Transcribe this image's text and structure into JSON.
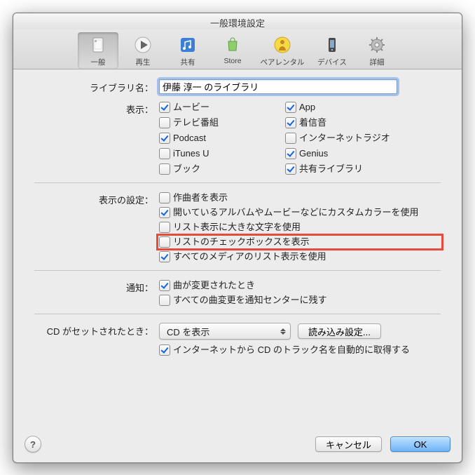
{
  "window": {
    "title": "一般環境設定"
  },
  "toolbar": {
    "items": [
      {
        "id": "general",
        "label": "一般",
        "selected": true
      },
      {
        "id": "playback",
        "label": "再生",
        "selected": false
      },
      {
        "id": "sharing",
        "label": "共有",
        "selected": false
      },
      {
        "id": "store",
        "label": "Store",
        "selected": false
      },
      {
        "id": "parental",
        "label": "ペアレンタル",
        "selected": false
      },
      {
        "id": "devices",
        "label": "デバイス",
        "selected": false
      },
      {
        "id": "advanced",
        "label": "詳細",
        "selected": false
      }
    ]
  },
  "form": {
    "library_name": {
      "label": "ライブラリ名：",
      "value": "伊藤 淳一 のライブラリ"
    },
    "show": {
      "label": "表示：",
      "items": [
        {
          "label": "ムービー",
          "checked": true
        },
        {
          "label": "App",
          "checked": true
        },
        {
          "label": "テレビ番組",
          "checked": false
        },
        {
          "label": "着信音",
          "checked": true
        },
        {
          "label": "Podcast",
          "checked": true
        },
        {
          "label": "インターネットラジオ",
          "checked": false
        },
        {
          "label": "iTunes U",
          "checked": false
        },
        {
          "label": "Genius",
          "checked": true
        },
        {
          "label": "ブック",
          "checked": false
        },
        {
          "label": "共有ライブラリ",
          "checked": true
        }
      ]
    },
    "view_settings": {
      "label": "表示の設定：",
      "items": [
        {
          "label": "作曲者を表示",
          "checked": false
        },
        {
          "label": "開いているアルバムやムービーなどにカスタムカラーを使用",
          "checked": true
        },
        {
          "label": "リスト表示に大きな文字を使用",
          "checked": false
        },
        {
          "label": "リストのチェックボックスを表示",
          "checked": false,
          "highlighted": true
        },
        {
          "label": "すべてのメディアのリスト表示を使用",
          "checked": true
        }
      ]
    },
    "notifications": {
      "label": "通知：",
      "items": [
        {
          "label": "曲が変更されたとき",
          "checked": true
        },
        {
          "label": "すべての曲変更を通知センターに残す",
          "checked": false
        }
      ]
    },
    "cd": {
      "label": "CD がセットされたとき：",
      "popup_value": "CD を表示",
      "import_settings_btn": "読み込み設定...",
      "auto_tracknames_label": "インターネットから CD のトラック名を自動的に取得する",
      "auto_tracknames_checked": true
    }
  },
  "footer": {
    "help": "?",
    "cancel": "キャンセル",
    "ok": "OK"
  },
  "highlight_color": "#e64a3b"
}
